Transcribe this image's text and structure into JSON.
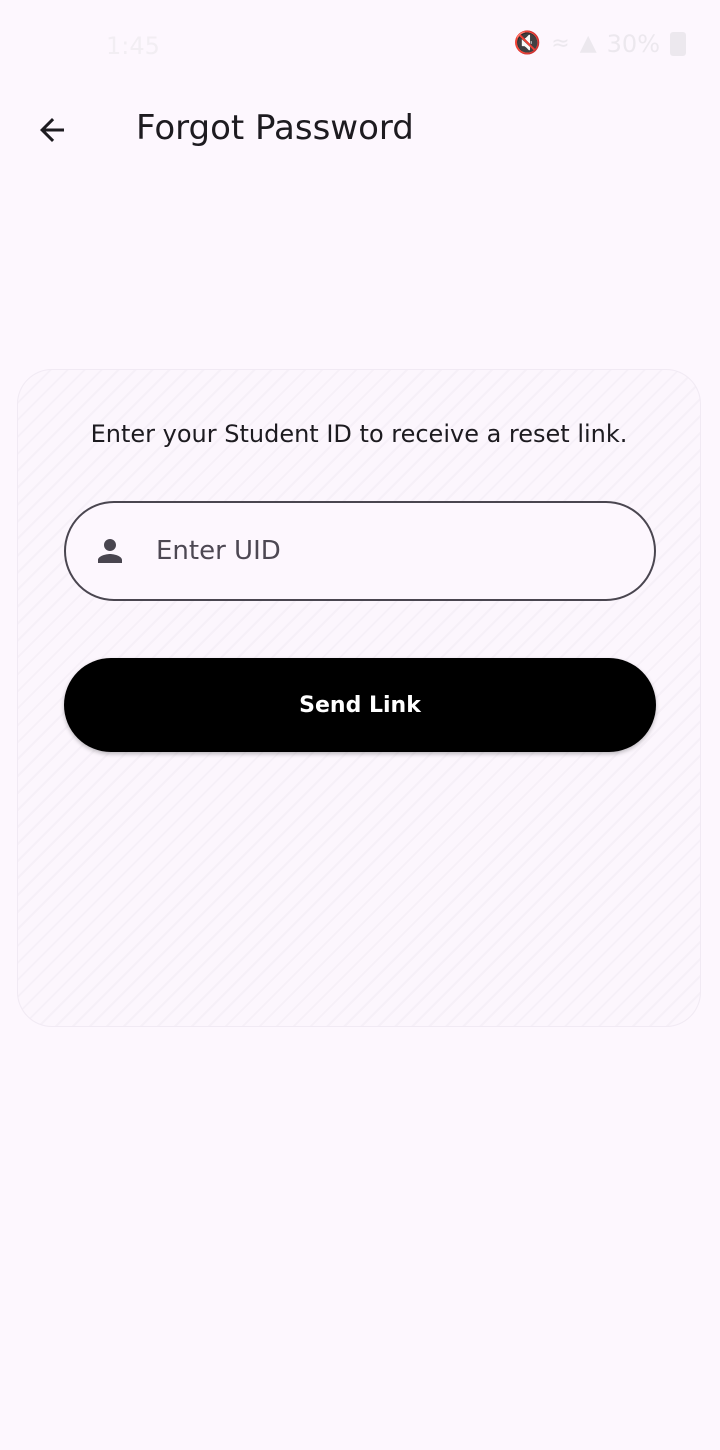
{
  "status_bar": {
    "time": "1:45",
    "battery": "30%",
    "icons": [
      "mute-icon",
      "wifi-icon",
      "signal-icon",
      "battery-icon"
    ]
  },
  "app_bar": {
    "title": "Forgot Password",
    "back_icon": "arrow-left-icon"
  },
  "form": {
    "instruction": "Enter your Student ID to receive a reset link.",
    "uid_placeholder": "Enter UID",
    "uid_value": "",
    "uid_icon": "person-icon",
    "submit_label": "Send Link"
  },
  "colors": {
    "background": "#fdf7fe",
    "button": "#000000",
    "button_text": "#ffffff",
    "field_border": "#4a4650",
    "text": "#1d1b20"
  }
}
